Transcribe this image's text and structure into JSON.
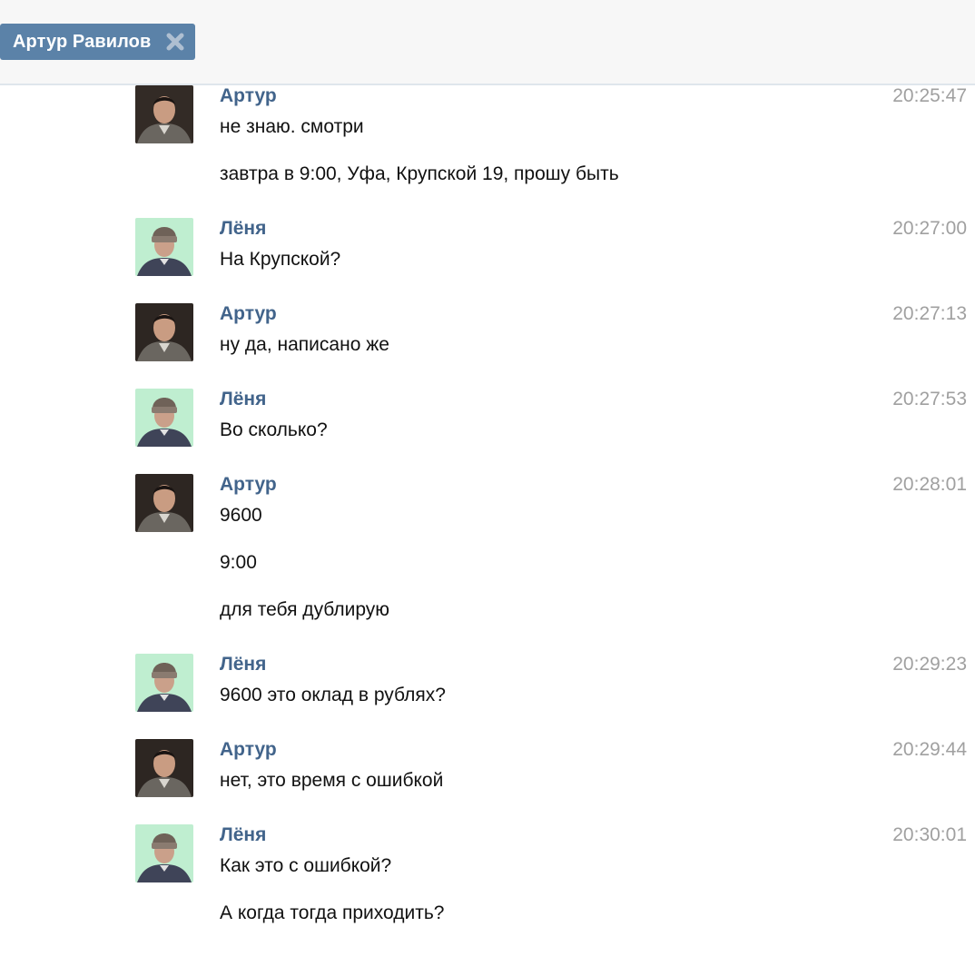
{
  "header": {
    "chat_tab_label": "Артур Равилов"
  },
  "messages": [
    {
      "author": "Артур",
      "time": "20:25:47",
      "lines": [
        "не знаю. смотри",
        "завтра в 9:00, Уфа, Крупской 19, прошу быть"
      ]
    },
    {
      "author": "Лёня",
      "time": "20:27:00",
      "lines": [
        "На Крупской?"
      ]
    },
    {
      "author": "Артур",
      "time": "20:27:13",
      "lines": [
        "ну да, написано же"
      ]
    },
    {
      "author": "Лёня",
      "time": "20:27:53",
      "lines": [
        "Во сколько?"
      ]
    },
    {
      "author": "Артур",
      "time": "20:28:01",
      "lines": [
        "9600",
        "9:00",
        "для тебя дублирую"
      ]
    },
    {
      "author": "Лёня",
      "time": "20:29:23",
      "lines": [
        "9600 это оклад в рублях?"
      ]
    },
    {
      "author": "Артур",
      "time": "20:29:44",
      "lines": [
        "нет, это время с ошибкой"
      ]
    },
    {
      "author": "Лёня",
      "time": "20:30:01",
      "lines": [
        "Как это с ошибкой?",
        "А когда тогда приходить?"
      ]
    }
  ]
}
